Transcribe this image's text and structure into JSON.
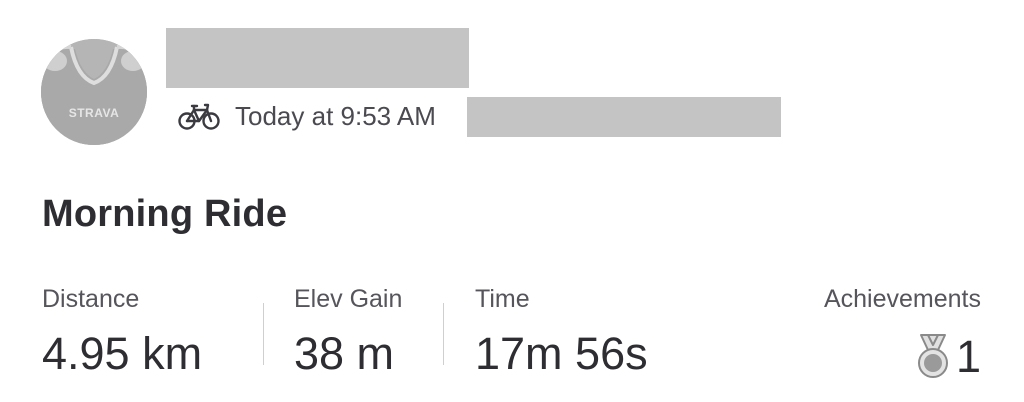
{
  "header": {
    "avatar_brand": "STRAVA",
    "timestamp": "Today at 9:53 AM",
    "activity_icon": "bike-icon"
  },
  "activity": {
    "title": "Morning Ride"
  },
  "stats": [
    {
      "label": "Distance",
      "value": "4.95 km"
    },
    {
      "label": "Elev Gain",
      "value": "38 m"
    },
    {
      "label": "Time",
      "value": "17m 56s"
    }
  ],
  "achievements": {
    "label": "Achievements",
    "value": "1",
    "icon": "medal-icon"
  }
}
